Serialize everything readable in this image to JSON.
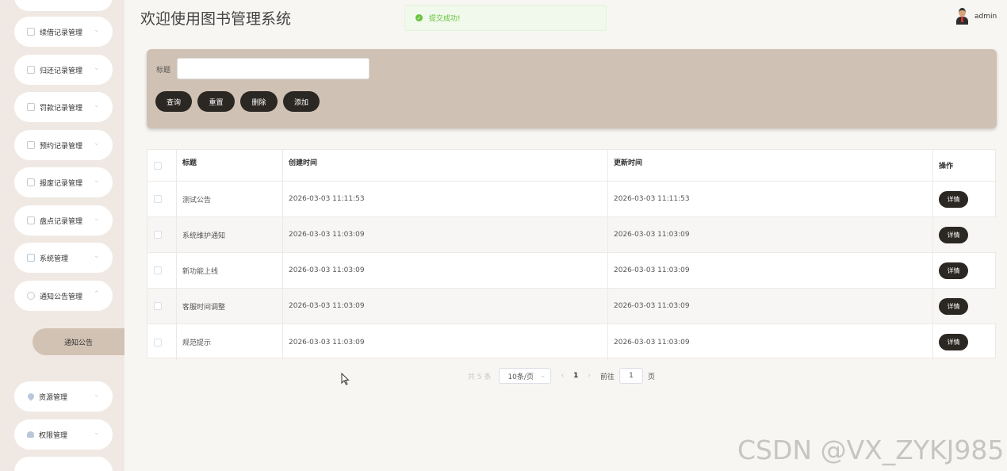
{
  "header": {
    "title": "欢迎使用图书管理系统",
    "toast": "提交成功!",
    "username": "admin"
  },
  "sidebar": {
    "items": [
      {
        "label": "续借记录管理"
      },
      {
        "label": "归还记录管理"
      },
      {
        "label": "罚款记录管理"
      },
      {
        "label": "预约记录管理"
      },
      {
        "label": "报废记录管理"
      },
      {
        "label": "盘点记录管理"
      },
      {
        "label": "系统管理"
      },
      {
        "label": "通知公告管理"
      },
      {
        "label": "资源管理"
      },
      {
        "label": "权限管理"
      }
    ],
    "active_sub": "通知公告"
  },
  "search": {
    "label": "标题",
    "value": "",
    "buttons": {
      "query": "查询",
      "reset": "重置",
      "delete": "删除",
      "add": "添加"
    }
  },
  "table": {
    "headers": {
      "title": "标题",
      "created": "创建时间",
      "updated": "更新时间",
      "action": "操作"
    },
    "rows": [
      {
        "title": "测试公告",
        "created": "2026-03-03 11:11:53",
        "updated": "2026-03-03 11:11:53",
        "action": "详情"
      },
      {
        "title": "系统维护通知",
        "created": "2026-03-03 11:03:09",
        "updated": "2026-03-03 11:03:09",
        "action": "详情"
      },
      {
        "title": "新功能上线",
        "created": "2026-03-03 11:03:09",
        "updated": "2026-03-03 11:03:09",
        "action": "详情"
      },
      {
        "title": "客服时间调整",
        "created": "2026-03-03 11:03:09",
        "updated": "2026-03-03 11:03:09",
        "action": "详情"
      },
      {
        "title": "规范提示",
        "created": "2026-03-03 11:03:09",
        "updated": "2026-03-03 11:03:09",
        "action": "详情"
      }
    ]
  },
  "pagination": {
    "total": "共 5 条",
    "page_size": "10条/页",
    "current_page": "1",
    "goto_label": "前往",
    "goto_value": "1",
    "page_suffix": "页"
  },
  "watermark": "CSDN @VX_ZYKJ985"
}
